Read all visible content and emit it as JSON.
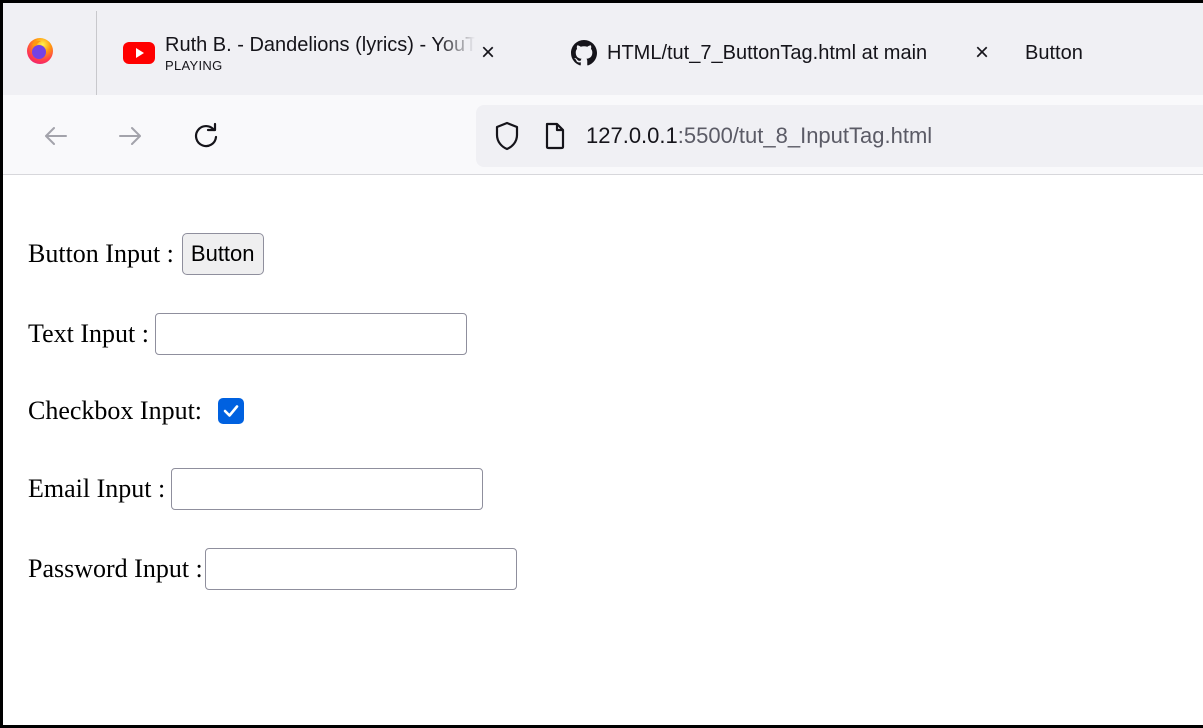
{
  "tabs": [
    {
      "title": "Ruth B. - Dandelions (lyrics) - YouTube",
      "subtitle": "PLAYING",
      "favicon": "youtube-icon"
    },
    {
      "title": "HTML/tut_7_ButtonTag.html at main",
      "favicon": "github-icon"
    },
    {
      "title": "Button"
    }
  ],
  "urlbar": {
    "host": "127.0.0.1",
    "rest": ":5500/tut_8_InputTag.html"
  },
  "page": {
    "button_row_label": "Button Input :",
    "button_label": "Button",
    "text_row_label": "Text Input :",
    "text_value": "",
    "checkbox_row_label": "Checkbox Input:",
    "checkbox_checked": true,
    "email_row_label": "Email Input :",
    "email_value": "",
    "password_row_label": "Password Input :",
    "password_value": ""
  },
  "colors": {
    "tabstrip_bg": "#f0f0f4",
    "checkbox_accent": "#0061e0",
    "youtube_red": "#ff0000"
  }
}
